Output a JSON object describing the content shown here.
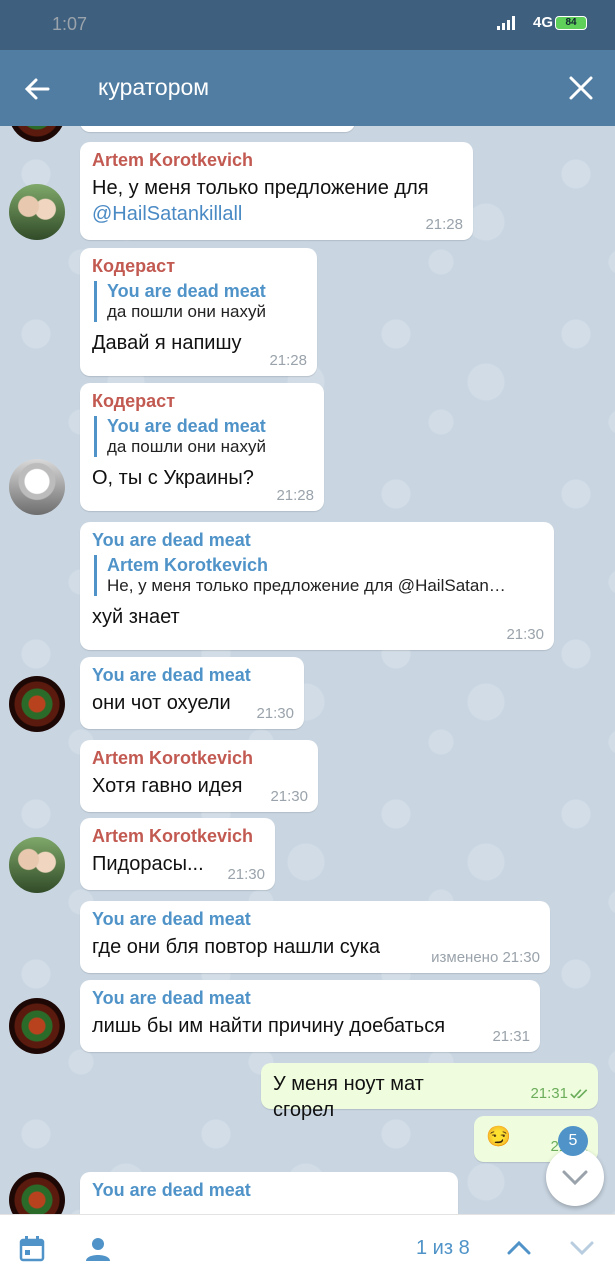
{
  "status_bar": {
    "time": "1:07",
    "network": "4G",
    "battery": "84"
  },
  "app_bar": {
    "search_query": "куратором"
  },
  "messages": [
    {
      "sender": "Artem Korotkevich",
      "text": "Не, у меня только предложение для ",
      "mention": "@HailSatankillall",
      "time": "21:28"
    },
    {
      "sender": "Кодераст",
      "reply_name": "You are dead meat",
      "reply_text": "да пошли они нахуй",
      "text": "Давай я напишу",
      "time": "21:28"
    },
    {
      "sender": "Кодераст",
      "reply_name": "You are dead meat",
      "reply_text": "да пошли они нахуй",
      "text": "О, ты с Украины?",
      "time": "21:28"
    },
    {
      "sender": "You are dead meat",
      "reply_name": "Artem Korotkevich",
      "reply_text": "Не, у меня только предложение для @HailSatan…",
      "text": "хуй знает",
      "time": "21:30"
    },
    {
      "sender": "You are dead meat",
      "text": "они чот охуели",
      "time": "21:30"
    },
    {
      "sender": "Artem Korotkevich",
      "text": "Хотя гавно идея",
      "time": "21:30"
    },
    {
      "sender": "Artem Korotkevich",
      "text": "Пидорасы...",
      "time": "21:30"
    },
    {
      "sender": "You are dead meat",
      "text": "где они бля повтор нашли сука",
      "time": "изменено 21:30"
    },
    {
      "sender": "You are dead meat",
      "text": "лишь бы им найти причину доебаться",
      "time": "21:31"
    },
    {
      "sender": "",
      "text": "У меня ноут мат сгорел",
      "time": "21:31"
    },
    {
      "sender": "",
      "text": "😏",
      "time": "21:31"
    },
    {
      "sender": "You are dead meat",
      "text": "",
      "time": ""
    }
  ],
  "scroll_button": {
    "unread_count": "5"
  },
  "bottom_bar": {
    "counter": "1 из 8"
  },
  "colors": {
    "header": "#517da2",
    "status_bar": "#3f5f7e",
    "accent": "#4f93c8",
    "sender_red": "#c25a52",
    "outgoing_bubble": "#effdde"
  }
}
